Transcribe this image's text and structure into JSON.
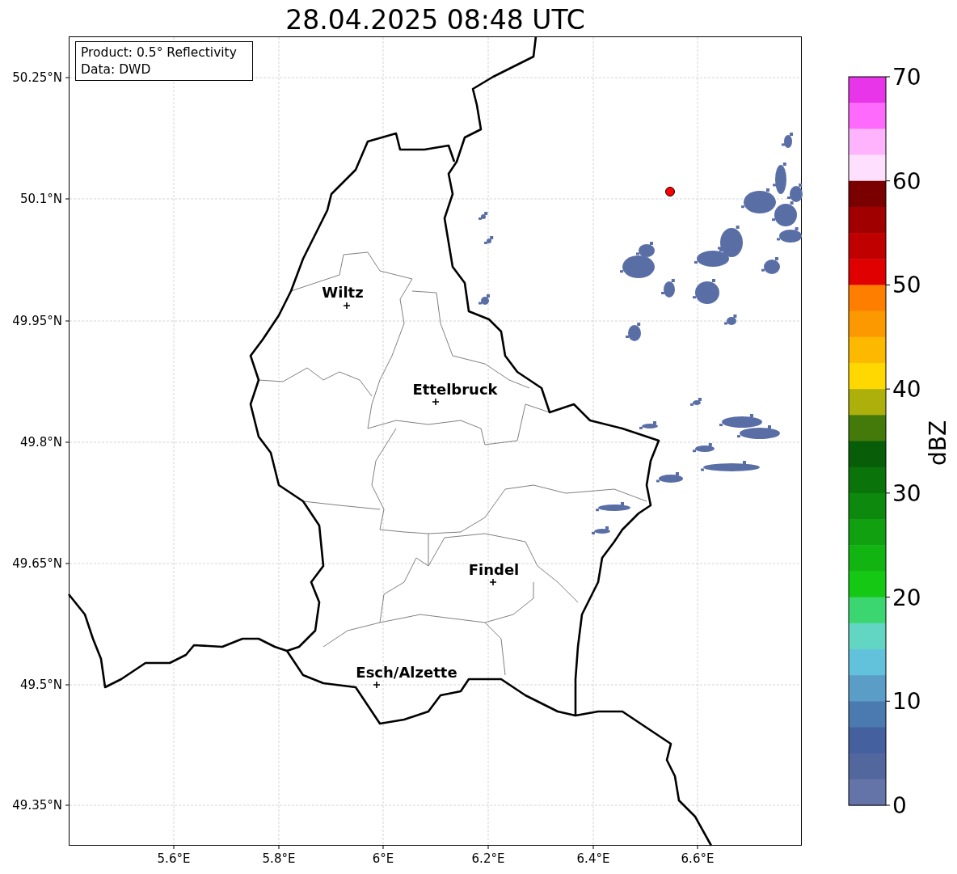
{
  "title": "28.04.2025 08:48 UTC",
  "info_box": [
    "Product: 0.5° Reflectivity",
    "Data: DWD"
  ],
  "y_ticks": [
    "50.25°N",
    "50.1°N",
    "49.95°N",
    "49.8°N",
    "49.65°N",
    "49.5°N",
    "49.35°N"
  ],
  "x_ticks": [
    "5.6°E",
    "5.8°E",
    "6°E",
    "6.2°E",
    "6.4°E",
    "6.6°E"
  ],
  "cities": [
    {
      "name": "Wiltz"
    },
    {
      "name": "Ettelbruck"
    },
    {
      "name": "Findel"
    },
    {
      "name": "Esch/Alzette"
    }
  ],
  "colorbar": {
    "label": "dBZ",
    "ticks": [
      "70",
      "60",
      "50",
      "40",
      "30",
      "20",
      "10",
      "0"
    ],
    "segments": [
      {
        "color": "#e935ea"
      },
      {
        "color": "#fd6afc"
      },
      {
        "color": "#fdb4fd"
      },
      {
        "color": "#fee0fe"
      },
      {
        "color": "#7a0000"
      },
      {
        "color": "#a00000"
      },
      {
        "color": "#c00000"
      },
      {
        "color": "#e00000"
      },
      {
        "color": "#fe7f00"
      },
      {
        "color": "#fd9900"
      },
      {
        "color": "#fdb800"
      },
      {
        "color": "#fed800"
      },
      {
        "color": "#adb00a"
      },
      {
        "color": "#437a0a"
      },
      {
        "color": "#085e08"
      },
      {
        "color": "#0a740a"
      },
      {
        "color": "#0d8a0d"
      },
      {
        "color": "#10a010"
      },
      {
        "color": "#11b411"
      },
      {
        "color": "#14c814"
      },
      {
        "color": "#3cd670"
      },
      {
        "color": "#62d6c2"
      },
      {
        "color": "#62c2dc"
      },
      {
        "color": "#5a9ec8"
      },
      {
        "color": "#4a7ab0"
      },
      {
        "color": "#44609f"
      },
      {
        "color": "#53679f"
      },
      {
        "color": "#6474a8"
      }
    ]
  }
}
